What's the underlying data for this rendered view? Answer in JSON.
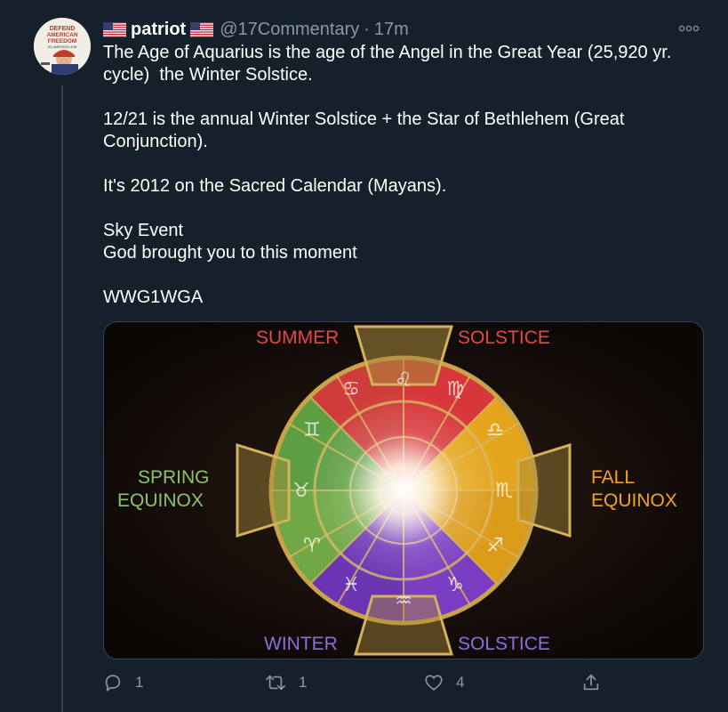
{
  "tweet": {
    "display_name": "patriot",
    "handle": "@17Commentary",
    "separator": "·",
    "time": "17m",
    "flag_icon": "us-flag-icon",
    "avatar_text_lines": [
      "DEFEND",
      "AMERICAN",
      "FREEDOM"
    ],
    "avatar_tagline": "DO AMERICA'S JOB",
    "text": "The Age of Aquarius is the age of the Angel in the Great Year (25,920 yr. cycle)  the Winter Solstice.\n\n12/21 is the annual Winter Solstice + the Star of Bethlehem (Great Conjunction).\n\nIt's 2012 on the Sacred Calendar (Mayans).\n\nSky Event\nGod brought you to this moment\n\nWWG1WGA"
  },
  "media": {
    "labels": {
      "summer": "SUMMER",
      "solstice_top": "SOLSTICE",
      "spring": "SPRING",
      "equinox_left": "EQUINOX",
      "fall": "FALL",
      "equinox_right": "EQUINOX",
      "winter": "WINTER",
      "solstice_bottom": "SOLSTICE"
    },
    "colors": {
      "summer": "#d7373b",
      "fall": "#e2a41c",
      "winter": "#6e35b8",
      "spring": "#5d9e43",
      "gold": "#c9a34a",
      "label_red": "#e04a48",
      "label_green": "#8cc46a",
      "label_gold": "#f2a41e",
      "label_purple": "#8d6ee0"
    }
  },
  "actions": {
    "reply_count": "1",
    "retweet_count": "1",
    "like_count": "4",
    "reply_icon": "reply-icon",
    "retweet_icon": "retweet-icon",
    "like_icon": "heart-icon",
    "share_icon": "share-icon",
    "more_icon": "more-options-icon"
  }
}
